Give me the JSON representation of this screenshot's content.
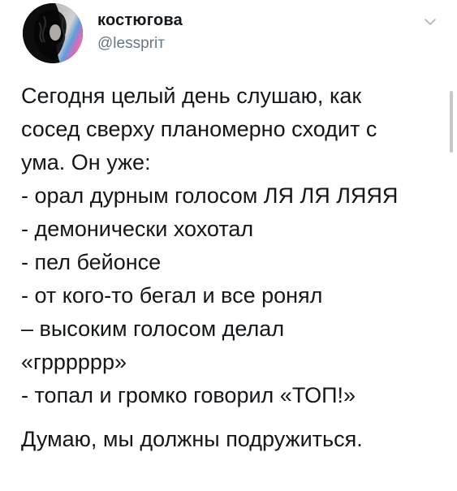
{
  "tweet": {
    "display_name": "костюгова",
    "handle": "@lesspriт",
    "avatar_icon": "profile-photo-icon",
    "menu_icon": "chevron-down-icon",
    "lines": [
      "Сегодня целый день слушаю, как",
      "сосед сверху планомерно сходит с",
      "ума. Он уже:",
      "- орал дурным голосом ЛЯ ЛЯ ЛЯЯЯ",
      "- демонически хохотал",
      "- пел бейонсе",
      "- от кого-то бегал и все ронял",
      "– высоким голосом делал",
      "«грррррр»",
      "- топал и громко говорил «ТОП!»"
    ],
    "closing": "Думаю, мы должны подружиться."
  },
  "colors": {
    "text": "#14171a",
    "secondary": "#657786",
    "caret": "#aab8c2"
  }
}
